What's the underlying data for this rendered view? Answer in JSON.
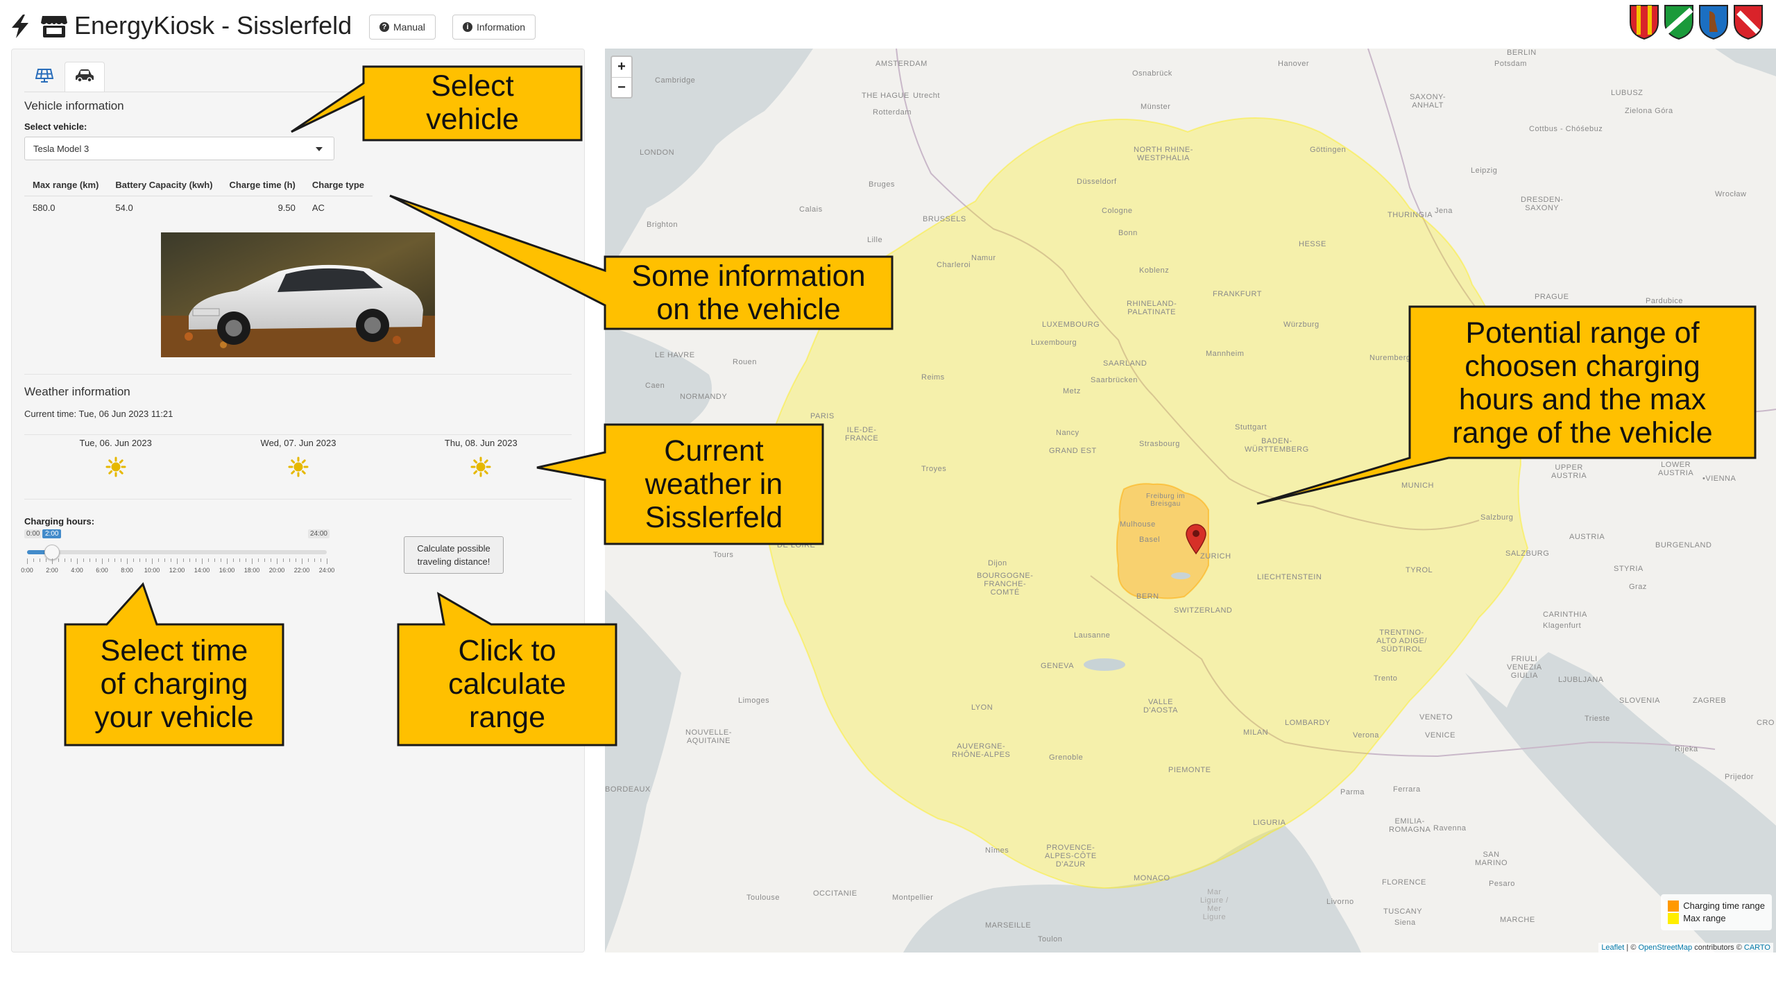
{
  "header": {
    "title": "EnergyKiosk - Sisslerfeld",
    "buttons": {
      "manual": "Manual",
      "information": "Information"
    },
    "icons": [
      "bolt-icon",
      "kiosk-icon"
    ],
    "crests": [
      "crest-1",
      "crest-2",
      "crest-3",
      "crest-4"
    ]
  },
  "sidebar": {
    "tabs": [
      {
        "icon": "solar-panel-icon",
        "active": false
      },
      {
        "icon": "car-icon",
        "active": true
      }
    ],
    "vehicle": {
      "section_title": "Vehicle information",
      "select_label": "Select vehicle:",
      "selected": "Tesla Model 3",
      "table": {
        "headers": [
          "Max range (km)",
          "Battery Capacity (kwh)",
          "Charge time (h)",
          "Charge type"
        ],
        "row": [
          "580.0",
          "54.0",
          "9.50",
          "AC"
        ]
      }
    },
    "weather": {
      "section_title": "Weather information",
      "current_time": "Current time: Tue, 06 Jun 2023 11:21",
      "days": [
        {
          "date": "Tue, 06. Jun 2023",
          "icon": "sun-icon"
        },
        {
          "date": "Wed, 07. Jun 2023",
          "icon": "sun-icon"
        },
        {
          "date": "Thu, 08. Jun 2023",
          "icon": "sun-icon"
        }
      ]
    },
    "charging": {
      "label": "Charging hours:",
      "min_label": "0:00",
      "value_label": "2:00",
      "max_label": "24:00",
      "value_hours": 2,
      "max_hours": 24,
      "ticks": [
        "0:00",
        "2:00",
        "4:00",
        "6:00",
        "8:00",
        "10:00",
        "12:00",
        "14:00",
        "16:00",
        "18:00",
        "20:00",
        "22:00",
        "24:00"
      ]
    },
    "calculate_button": [
      "Calculate possible",
      "traveling distance!"
    ]
  },
  "map": {
    "zoom_in": "+",
    "zoom_out": "−",
    "legend": [
      {
        "label": "Charging time range",
        "color": "#ff9900"
      },
      {
        "label": "Max range",
        "color": "#ffee00"
      }
    ],
    "attribution": {
      "leaflet": "Leaflet",
      "sep": " | © ",
      "osm": "OpenStreetMap",
      "contrib": " contributors © ",
      "carto": "CARTO"
    },
    "labels": {
      "amsterdam": "AMSTERDAM",
      "the_hague": "THE HAGUE",
      "utrecht": "Utrecht",
      "rotterdam": "Rotterdam",
      "osnabruck": "Osnabrück",
      "hanover": "Hanover",
      "berlin": "BERLIN",
      "potsdam": "Potsdam",
      "cambridge": "Cambridge",
      "london": "LONDON",
      "munster": "Münster",
      "saxony_anhalt": "SAXONY-\nANHALT",
      "lubusz": "LUBUSZ",
      "zielona": "Zielona Góra",
      "cottbus": "Cottbus - Chóśebuz",
      "north_rhine": "NORTH RHINE-\nWESTPHALIA",
      "gottingen": "Göttingen",
      "leipzig": "Leipzig",
      "dusseldorf": "Düsseldorf",
      "bruges": "Bruges",
      "calais": "Calais",
      "brussels": "BRUSSELS",
      "cologne": "Cologne",
      "thuringia": "THURINGIA",
      "jena": "Jena",
      "dresden": "DRESDEN-\nSAXONY",
      "wroclaw": "Wrocław",
      "brighton": "Brighton",
      "bonn": "Bonn",
      "hesse": "HESSE",
      "lille": "Lille",
      "charleroi": "Charleroi",
      "koblenz": "Koblenz",
      "frankfurt": "FRANKFURT",
      "namur": "Namur",
      "rhineland": "RHINELAND-\nPALATINATE",
      "luxembourg": "LUXEMBOURG",
      "wurzburg": "Würzburg",
      "prague": "PRAGUE",
      "pardubice": "Pardubice",
      "le_havre": "LE HAVRE",
      "rouen": "Rouen",
      "luxbourg_city": "Luxembourg",
      "saarland": "SAARLAND",
      "mannheim": "Mannheim",
      "nuremberg": "Nuremberg",
      "caen": "Caen",
      "normandy": "NORMANDY",
      "reims": "Reims",
      "saarbrucken": "Saarbrücken",
      "metz": "Metz",
      "paris": "PARIS",
      "stuttgart": "Stuttgart",
      "ile_de_france": "ILE-DE-\nFRANCE",
      "nancy": "Nancy",
      "strasbourg": "Strasbourg",
      "baden": "BADEN-\nWÜRTTEMBERG",
      "grand_est": "GRAND EST",
      "upper_austria": "UPPER\nAUSTRIA",
      "lower_austria": "LOWER\nAUSTRIA",
      "vienna": "•VIENNA",
      "troyes": "Troyes",
      "munich": "MUNICH",
      "freiburg": "Freiburg im\nBreisgau",
      "salzburg": "Salzburg",
      "mulhouse": "Mulhouse",
      "basel": "Basel",
      "zurich": "ZURICH",
      "austria": "AUSTRIA",
      "tours": "Tours",
      "de_loire": "DE LOIRE",
      "salzburg_reg": "SALZBURG",
      "burgenland": "BURGENLAND",
      "dijon": "Dijon",
      "liechtenstein": "LIECHTENSTEIN",
      "tyrol": "TYROL",
      "styria": "STYRIA",
      "bourgogne": "BOURGOGNE-\nFRANCHE-\nCOMTÉ",
      "bern": "BERN",
      "switzerland": "SWITZERLAND",
      "graz": "Graz",
      "carinthia": "CARINTHIA",
      "klagenfurt": "Klagenfurt",
      "lausanne": "Lausanne",
      "trentino": "TRENTINO-\nALTO ADIGE/\nSÜDTIROL",
      "geneva": "GENEVA",
      "friuli": "FRIULI\nVENEZIA\nGIULIA",
      "ljubljana": "LJUBLJANA",
      "trento": "Trento",
      "limoges": "Limoges",
      "slovenia": "SLOVENIA",
      "zagreb": "ZAGREB",
      "valle": "VALLE\nD'AOSTA",
      "lyon": "LYON",
      "trieste": "Trieste",
      "nouvelle": "NOUVELLE-\nAQUITAINE",
      "milan": "MILAN",
      "lombardy": "LOMBARDY",
      "veneto": "VENETO",
      "verona": "Verona",
      "venice": "VENICE",
      "cro": "CRO",
      "auvergne": "AUVERGNE-\nRHÔNE-ALPES",
      "grenoble": "Grenoble",
      "rijeka": "Rijeka",
      "piemonte": "PIEMONTE",
      "bordeaux": "BORDEAUX",
      "parma": "Parma",
      "ferrara": "Ferrara",
      "emilia": "EMILIA-\nROMAGNA",
      "ravenna": "Ravenna",
      "liguria": "LIGURIA",
      "provence": "PROVENCE-\nALPES-CÔTE\nD'AZUR",
      "nimes": "Nîmes",
      "san_marino": "SAN\nMARINO",
      "monaco": "MONACO",
      "florence": "FLORENCE",
      "mar_ligure": "Mar\nLigure /\nMer\nLigure",
      "occitanie": "OCCITANIE",
      "toulouse": "Toulouse",
      "montpellier": "Montpellier",
      "livorno": "Livorno",
      "tuscany": "TUSCANY",
      "siena": "Siena",
      "marche": "MARCHE",
      "marseille": "MARSEILLE",
      "toulon": "Toulon",
      "pesaro": "Pesaro",
      "prijedor": "Prijedor"
    }
  },
  "callouts": {
    "select_vehicle": [
      "Select",
      "vehicle"
    ],
    "vehicle_info": [
      "Some information",
      "on the vehicle"
    ],
    "weather": [
      "Current",
      "weather in",
      "Sisslerfeld"
    ],
    "range": [
      "Potential range of",
      "choosen charging",
      "hours and the max",
      "range of the vehicle"
    ],
    "charging_time": [
      "Select time",
      "of charging",
      "your vehicle"
    ],
    "calculate": [
      "Click to",
      "calculate",
      "range"
    ]
  }
}
